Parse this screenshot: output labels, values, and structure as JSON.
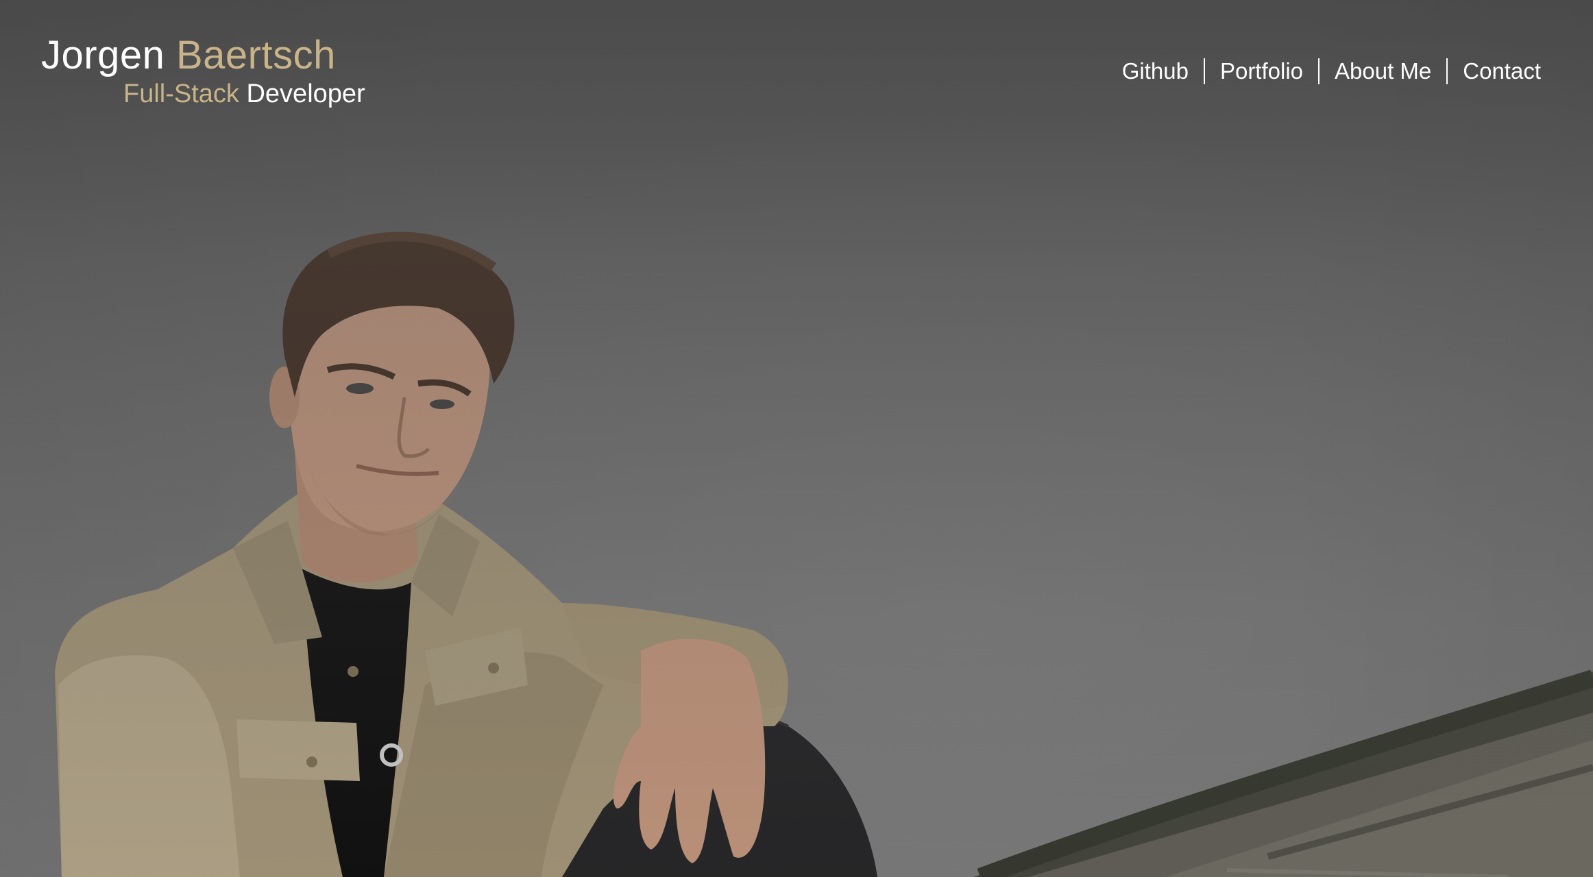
{
  "header": {
    "name_first": "Jorgen",
    "name_last": "Baertsch",
    "subtitle_accent": "Full-Stack",
    "subtitle_rest": "Developer"
  },
  "nav": {
    "items": [
      {
        "label": "Github"
      },
      {
        "label": "Portfolio"
      },
      {
        "label": "About Me"
      },
      {
        "label": "Contact"
      }
    ]
  },
  "colors": {
    "accent": "#c9b389",
    "text": "#ffffff",
    "overlay": "#5b5b5b"
  }
}
